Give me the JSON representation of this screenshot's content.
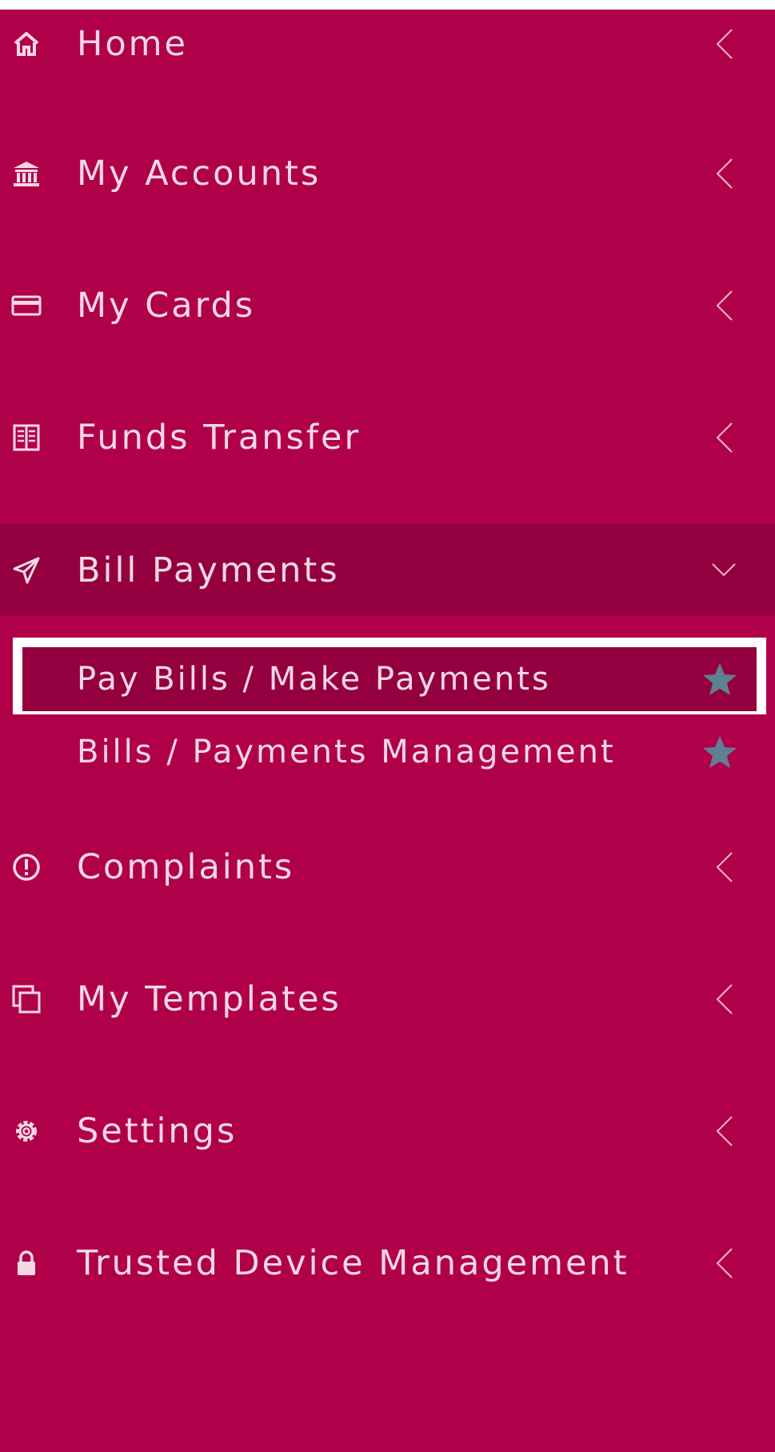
{
  "menu": {
    "items": [
      {
        "label": "Home",
        "icon": "home-icon"
      },
      {
        "label": "My Accounts",
        "icon": "bank-icon"
      },
      {
        "label": "My Cards",
        "icon": "card-icon"
      },
      {
        "label": "Funds Transfer",
        "icon": "transfer-icon"
      },
      {
        "label": "Bill Payments",
        "icon": "paper-plane-icon",
        "expanded": true
      },
      {
        "label": "Complaints",
        "icon": "alert-circle-icon"
      },
      {
        "label": "My Templates",
        "icon": "copy-icon"
      },
      {
        "label": "Settings",
        "icon": "gear-icon"
      },
      {
        "label": "Trusted Device Management",
        "icon": "lock-icon"
      }
    ],
    "bill_payments_sub": [
      {
        "label": "Pay Bills / Make Payments",
        "selected": true,
        "favorite": true
      },
      {
        "label": "Bills / Payments Management",
        "selected": false,
        "favorite": true
      }
    ]
  },
  "colors": {
    "background": "#b0004a",
    "active": "#94003f",
    "star": "#5f7f92",
    "highlight_border": "#ffffff"
  }
}
